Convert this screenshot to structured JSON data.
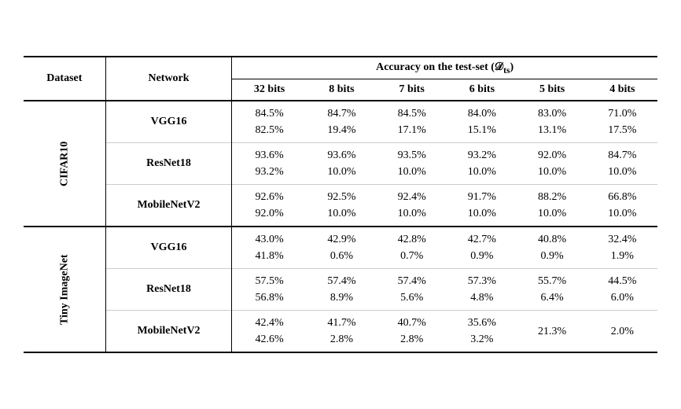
{
  "table": {
    "caption": "Accuracy on the test-set",
    "caption_sub": "(D_ts)",
    "headers": {
      "dataset": "Dataset",
      "network": "Network",
      "bits": [
        "32 bits",
        "8 bits",
        "7 bits",
        "6 bits",
        "5 bits",
        "4 bits"
      ]
    },
    "sections": [
      {
        "dataset": "CIFAR10",
        "rows": [
          {
            "network": "VGG16",
            "values": [
              {
                "top": "84.5%",
                "bottom": "82.5%"
              },
              {
                "top": "84.7%",
                "bottom": "19.4%"
              },
              {
                "top": "84.5%",
                "bottom": "17.1%"
              },
              {
                "top": "84.0%",
                "bottom": "15.1%"
              },
              {
                "top": "83.0%",
                "bottom": "13.1%"
              },
              {
                "top": "71.0%",
                "bottom": "17.5%"
              }
            ]
          },
          {
            "network": "ResNet18",
            "values": [
              {
                "top": "93.6%",
                "bottom": "93.2%"
              },
              {
                "top": "93.6%",
                "bottom": "10.0%"
              },
              {
                "top": "93.5%",
                "bottom": "10.0%"
              },
              {
                "top": "93.2%",
                "bottom": "10.0%"
              },
              {
                "top": "92.0%",
                "bottom": "10.0%"
              },
              {
                "top": "84.7%",
                "bottom": "10.0%"
              }
            ]
          },
          {
            "network": "MobileNetV2",
            "values": [
              {
                "top": "92.6%",
                "bottom": "92.0%"
              },
              {
                "top": "92.5%",
                "bottom": "10.0%"
              },
              {
                "top": "92.4%",
                "bottom": "10.0%"
              },
              {
                "top": "91.7%",
                "bottom": "10.0%"
              },
              {
                "top": "88.2%",
                "bottom": "10.0%"
              },
              {
                "top": "66.8%",
                "bottom": "10.0%"
              }
            ]
          }
        ]
      },
      {
        "dataset": "Tiny ImageNet",
        "rows": [
          {
            "network": "VGG16",
            "values": [
              {
                "top": "43.0%",
                "bottom": "41.8%"
              },
              {
                "top": "42.9%",
                "bottom": "0.6%"
              },
              {
                "top": "42.8%",
                "bottom": "0.7%"
              },
              {
                "top": "42.7%",
                "bottom": "0.9%"
              },
              {
                "top": "40.8%",
                "bottom": "0.9%"
              },
              {
                "top": "32.4%",
                "bottom": "1.9%"
              }
            ]
          },
          {
            "network": "ResNet18",
            "values": [
              {
                "top": "57.5%",
                "bottom": "56.8%"
              },
              {
                "top": "57.4%",
                "bottom": "8.9%"
              },
              {
                "top": "57.4%",
                "bottom": "5.6%"
              },
              {
                "top": "57.3%",
                "bottom": "4.8%"
              },
              {
                "top": "55.7%",
                "bottom": "6.4%"
              },
              {
                "top": "44.5%",
                "bottom": "6.0%"
              }
            ]
          },
          {
            "network": "MobileNetV2",
            "values": [
              {
                "top": "42.4%",
                "bottom": "42.6%"
              },
              {
                "top": "41.7%",
                "bottom": "2.8%"
              },
              {
                "top": "40.7%",
                "bottom": "2.8%"
              },
              {
                "top": "35.6%",
                "bottom": "3.2%"
              },
              {
                "top": "21.3%",
                "bottom": ""
              },
              {
                "top": "2.0%",
                "bottom": ""
              }
            ]
          }
        ]
      }
    ]
  }
}
